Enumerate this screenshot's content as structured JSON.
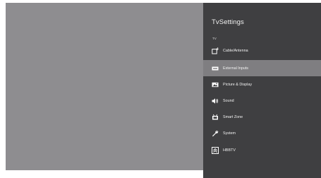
{
  "panel": {
    "title": "TvSettings",
    "section_label": "TV"
  },
  "menu": {
    "items": [
      {
        "label": "Cable/Antenna",
        "icon": "cable-antenna-icon"
      },
      {
        "label": "External Inputs",
        "icon": "external-inputs-icon",
        "selected": true
      },
      {
        "label": "Picture & Display",
        "icon": "picture-icon"
      },
      {
        "label": "Sound",
        "icon": "sound-icon"
      },
      {
        "label": "Smart Zone",
        "icon": "smart-zone-icon"
      },
      {
        "label": "System",
        "icon": "wrench-icon"
      },
      {
        "label": "HBBTV",
        "icon": "hbbtv-icon"
      }
    ]
  },
  "colors": {
    "screen_background": "#8e8d90",
    "panel_background": "#3f3f41",
    "selected_item": "#7f7e81"
  }
}
